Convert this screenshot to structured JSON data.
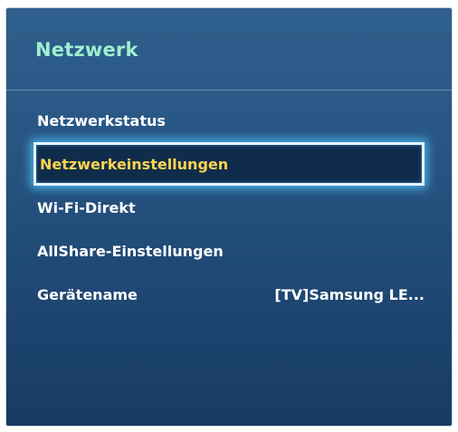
{
  "menu": {
    "title": "Netzwerk",
    "items": [
      {
        "label": "Netzwerkstatus"
      },
      {
        "label": "Netzwerkeinstellungen",
        "selected": true
      },
      {
        "label": "Wi-Fi-Direkt"
      },
      {
        "label": "AllShare-Einstellungen"
      },
      {
        "label": "Gerätename",
        "value": "[TV]Samsung LE..."
      }
    ]
  },
  "colors": {
    "title": "#9ef0cf",
    "selected_text": "#ffd44d",
    "selected_glow": "#50c8ff",
    "panel_background": "#2a5886"
  }
}
